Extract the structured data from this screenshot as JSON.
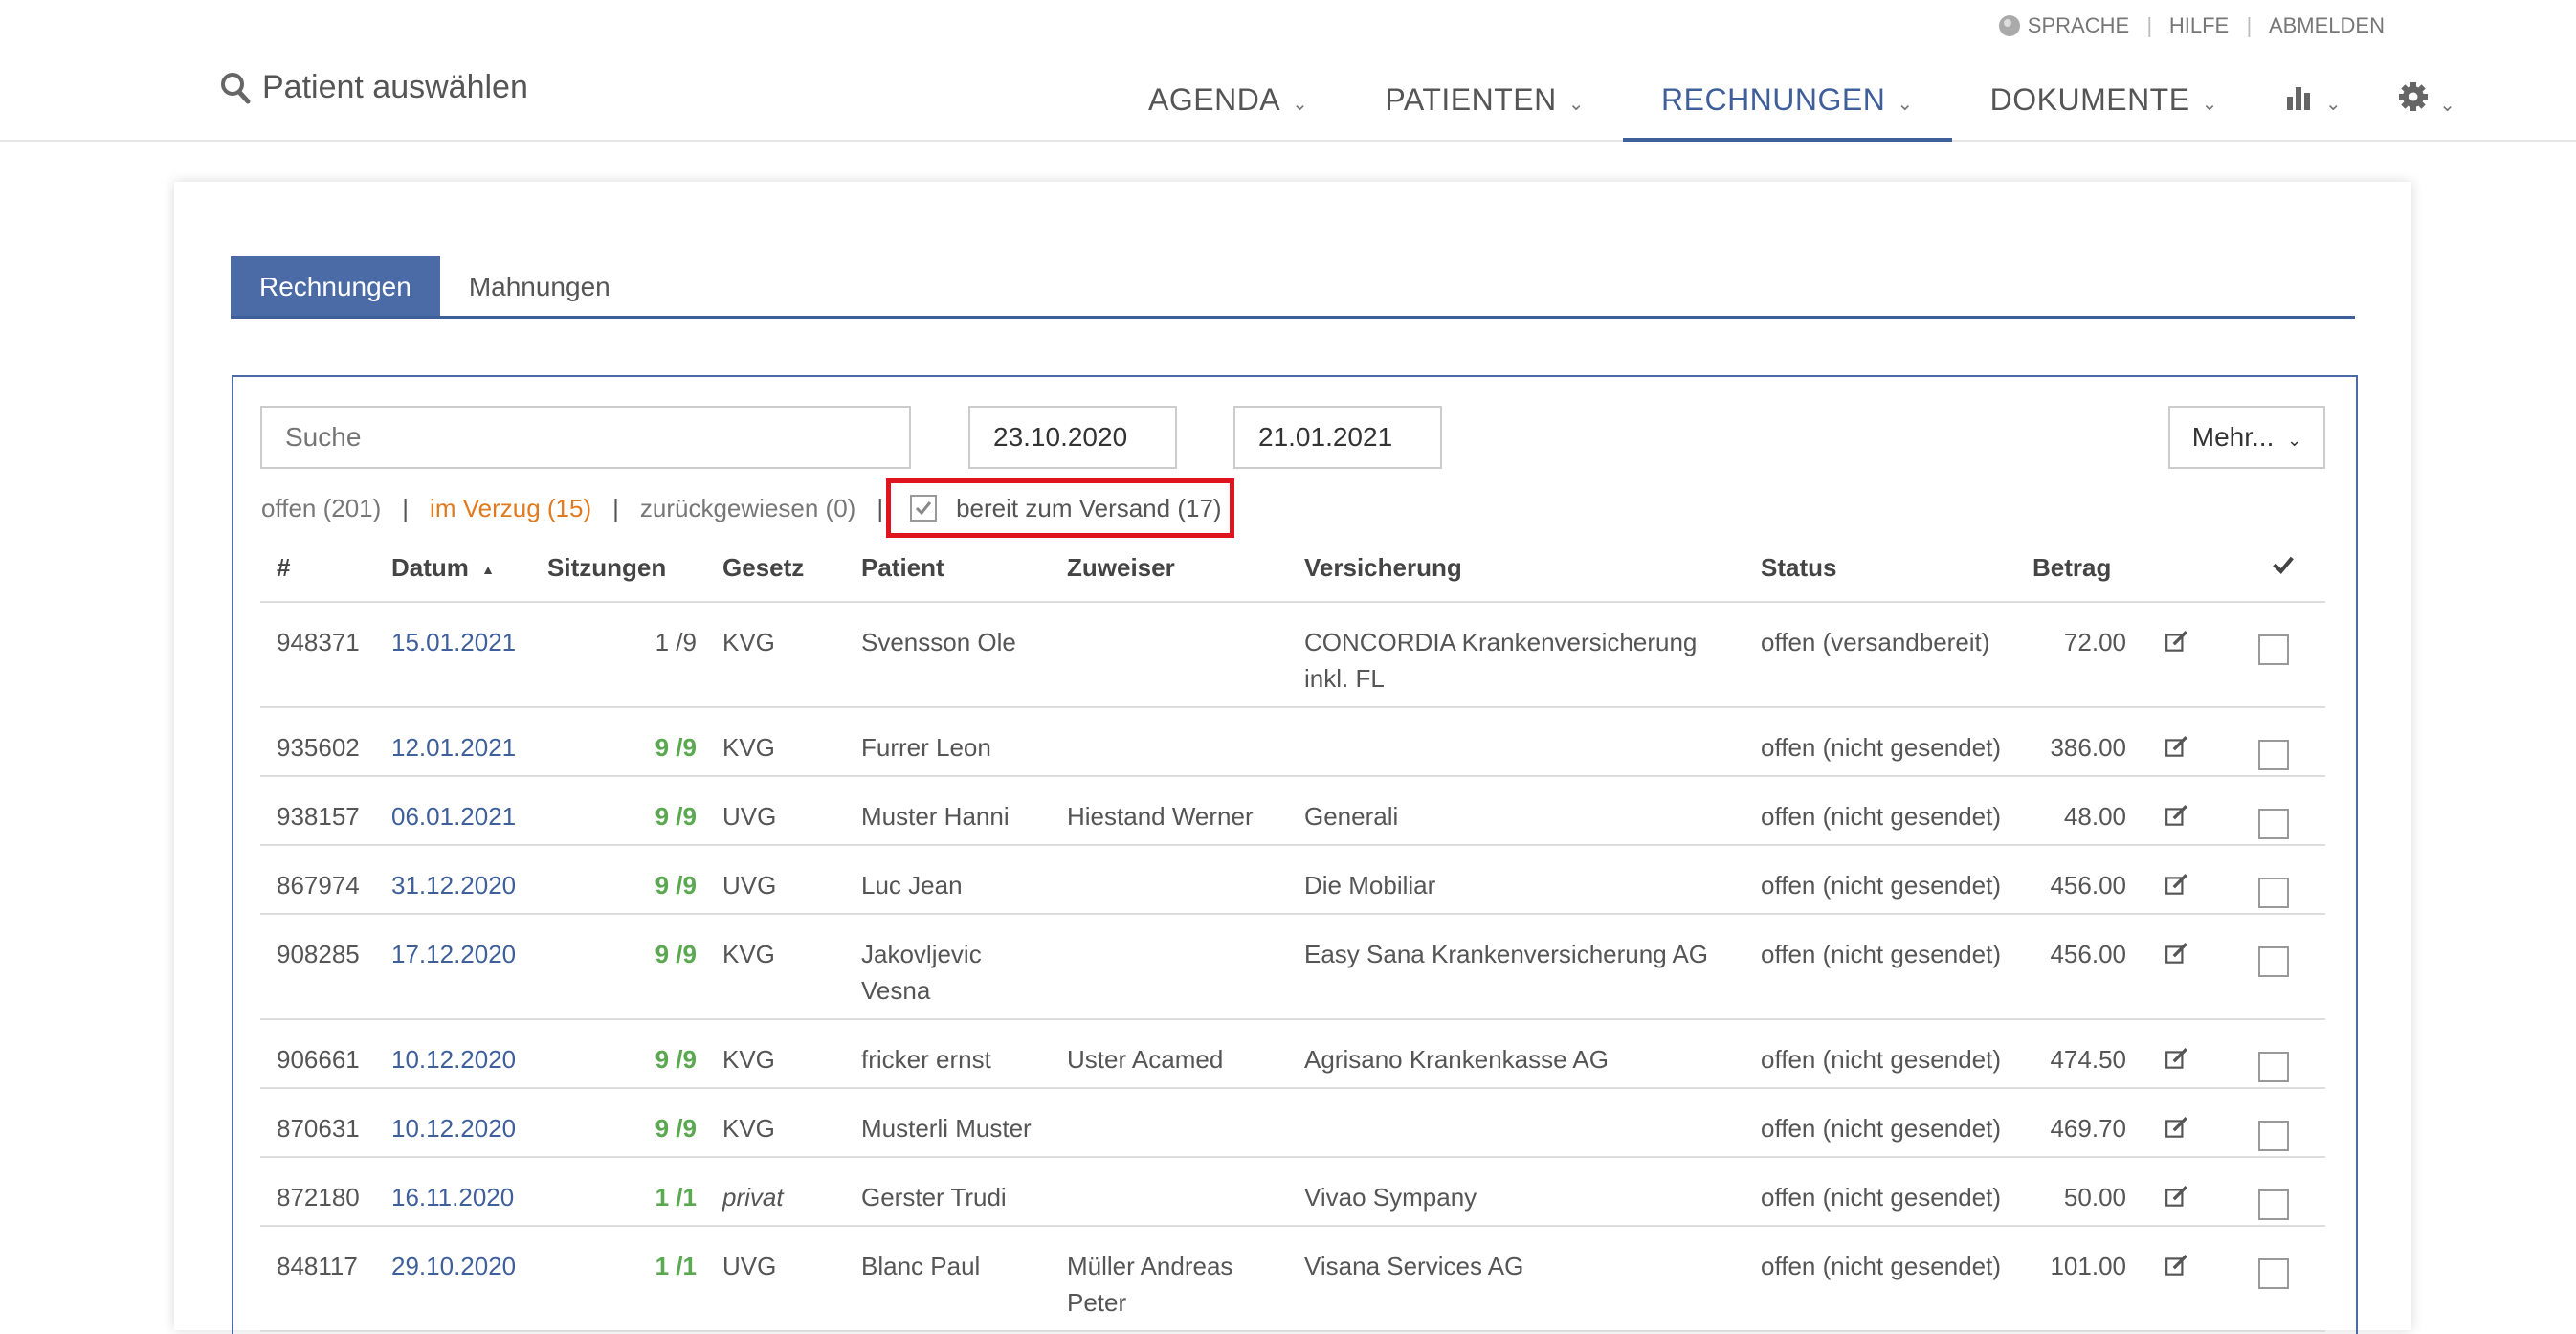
{
  "header": {
    "utility": [
      "SPRACHE",
      "HILFE",
      "ABMELDEN"
    ],
    "patient_select": "Patient auswählen",
    "nav": [
      {
        "label": "AGENDA",
        "active": false
      },
      {
        "label": "PATIENTEN",
        "active": false
      },
      {
        "label": "RECHNUNGEN",
        "active": true
      },
      {
        "label": "DOKUMENTE",
        "active": false
      }
    ],
    "nav_icons": [
      "bar-chart-icon",
      "gear-icon"
    ],
    "accent_color": "#3f5f9b"
  },
  "tabs": [
    {
      "label": "Rechnungen",
      "active": true
    },
    {
      "label": "Mahnungen",
      "active": false
    }
  ],
  "search": {
    "placeholder": "Suche",
    "date_from": "23.10.2020",
    "date_to": "21.01.2021",
    "more_label": "Mehr..."
  },
  "filters": {
    "open": "offen (201)",
    "overdue": "im Verzug (15)",
    "rejected": "zurückgewiesen (0)",
    "ready": "bereit zum Versand (17)",
    "ready_checked": true
  },
  "table": {
    "headers": [
      "#",
      "Datum",
      "Sitzungen",
      "Gesetz",
      "Patient",
      "Zuweiser",
      "Versicherung",
      "Status",
      "Betrag"
    ],
    "sort_indicator": "▲",
    "rows": [
      {
        "num": "948371",
        "date": "15.01.2021",
        "sessions": "1 /9",
        "complete": false,
        "law": "KVG",
        "patient": "Svensson Ole",
        "referrer": "",
        "insurance": "CONCORDIA Krankenversicherung inkl. FL",
        "status": "offen (versandbereit)",
        "amount": "72.00"
      },
      {
        "num": "935602",
        "date": "12.01.2021",
        "sessions": "9 /9",
        "complete": true,
        "law": "KVG",
        "patient": "Furrer Leon",
        "referrer": "",
        "insurance": "",
        "status": "offen (nicht gesendet)",
        "amount": "386.00"
      },
      {
        "num": "938157",
        "date": "06.01.2021",
        "sessions": "9 /9",
        "complete": true,
        "law": "UVG",
        "patient": "Muster Hanni",
        "referrer": "Hiestand Werner",
        "insurance": "Generali",
        "status": "offen (nicht gesendet)",
        "amount": "48.00"
      },
      {
        "num": "867974",
        "date": "31.12.2020",
        "sessions": "9 /9",
        "complete": true,
        "law": "UVG",
        "patient": "Luc Jean",
        "referrer": "",
        "insurance": "Die Mobiliar",
        "status": "offen (nicht gesendet)",
        "amount": "456.00"
      },
      {
        "num": "908285",
        "date": "17.12.2020",
        "sessions": "9 /9",
        "complete": true,
        "law": "KVG",
        "patient": "Jakovljevic Vesna",
        "referrer": "",
        "insurance": "Easy Sana Krankenversicherung AG",
        "status": "offen (nicht gesendet)",
        "amount": "456.00"
      },
      {
        "num": "906661",
        "date": "10.12.2020",
        "sessions": "9 /9",
        "complete": true,
        "law": "KVG",
        "patient": "fricker ernst",
        "referrer": "Uster Acamed",
        "insurance": "Agrisano Krankenkasse AG",
        "status": "offen (nicht gesendet)",
        "amount": "474.50"
      },
      {
        "num": "870631",
        "date": "10.12.2020",
        "sessions": "9 /9",
        "complete": true,
        "law": "KVG",
        "patient": "Musterli Muster",
        "referrer": "",
        "insurance": "",
        "status": "offen (nicht gesendet)",
        "amount": "469.70"
      },
      {
        "num": "872180",
        "date": "16.11.2020",
        "sessions": "1 /1",
        "complete": true,
        "law": "privat",
        "patient": "Gerster Trudi",
        "referrer": "",
        "insurance": "Vivao Sympany",
        "status": "offen (nicht gesendet)",
        "amount": "50.00"
      },
      {
        "num": "848117",
        "date": "29.10.2020",
        "sessions": "1 /1",
        "complete": true,
        "law": "UVG",
        "patient": "Blanc Paul",
        "referrer": "Müller Andreas Peter",
        "insurance": "Visana Services AG",
        "status": "offen (nicht gesendet)",
        "amount": "101.00"
      }
    ]
  }
}
